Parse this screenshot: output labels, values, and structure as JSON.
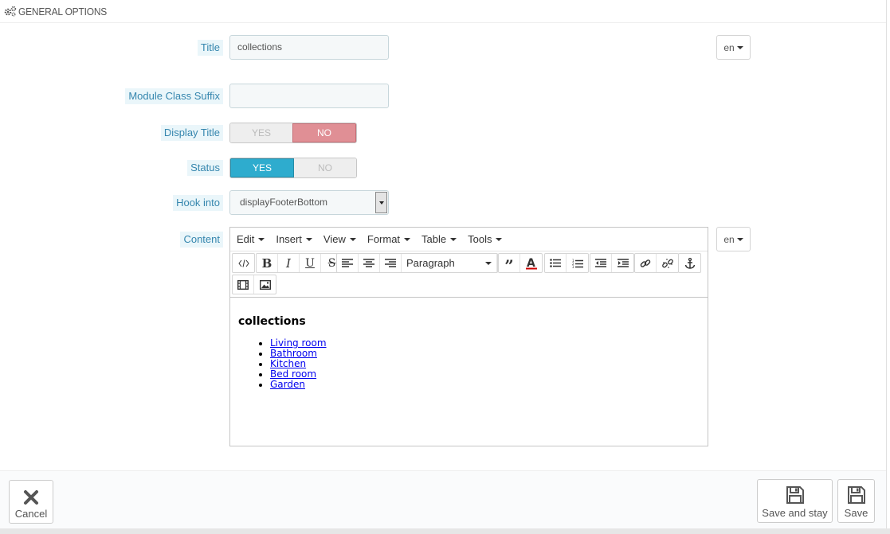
{
  "panel": {
    "heading": "GENERAL OPTIONS"
  },
  "fields": {
    "title": {
      "label": "Title",
      "value": "collections",
      "lang": "en"
    },
    "suffix": {
      "label": "Module Class Suffix",
      "value": ""
    },
    "display_title": {
      "label": "Display Title",
      "yes": "YES",
      "no": "NO",
      "selected": "NO"
    },
    "status": {
      "label": "Status",
      "yes": "YES",
      "no": "NO",
      "selected": "YES"
    },
    "hook": {
      "label": "Hook into",
      "value": "displayFooterBottom"
    },
    "content": {
      "label": "Content",
      "lang": "en"
    }
  },
  "editor": {
    "menus": [
      "Edit",
      "Insert",
      "View",
      "Format",
      "Table",
      "Tools"
    ],
    "block_format": "Paragraph",
    "heading": "collections",
    "links": [
      "Living room",
      "Bathroom",
      "Kitchen",
      "Bed room",
      "Garden"
    ]
  },
  "footer": {
    "cancel": "Cancel",
    "save_stay": "Save and stay",
    "save": "Save"
  },
  "colors": {
    "label_text": "#3586ae",
    "label_bg": "#eaf6fa",
    "switch_yes": "#2eacce",
    "switch_no": "#e08f95"
  }
}
